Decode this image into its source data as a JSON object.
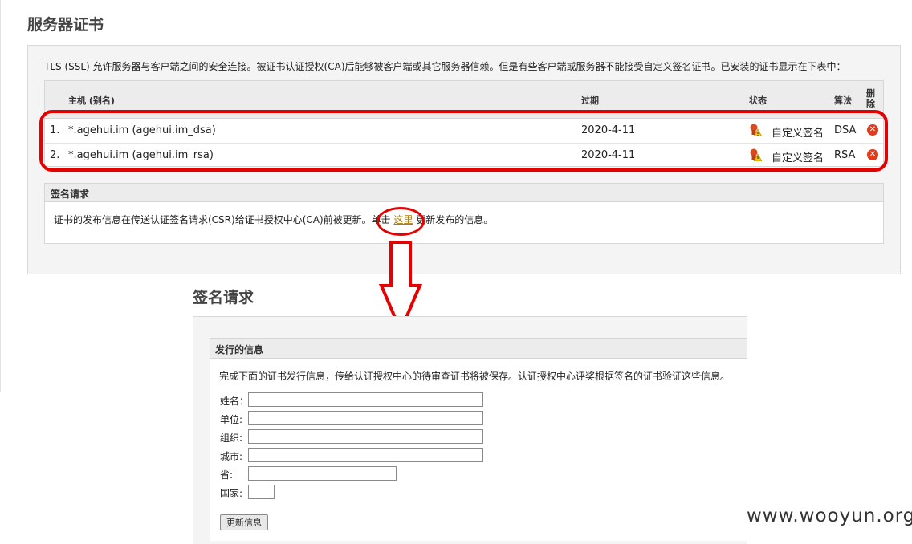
{
  "page": {
    "title": "服务器证书",
    "intro": "TLS (SSL) 允许服务器与客户端之间的安全连接。被证书认证授权(CA)后能够被客户端或其它服务器信赖。但是有些客户端或服务器不能接受自定义签名证书。已安装的证书显示在下表中："
  },
  "cert_table": {
    "headers": {
      "host": "主机 (别名)",
      "expires": "过期",
      "status": "状态",
      "algorithm": "算法",
      "delete": "删除"
    },
    "rows": [
      {
        "index": "1.",
        "host": "*.agehui.im (agehui.im_dsa)",
        "expires": "2020-4-11",
        "status": "自定义签名",
        "algorithm": "DSA"
      },
      {
        "index": "2.",
        "host": "*.agehui.im (agehui.im_rsa)",
        "expires": "2020-4-11",
        "status": "自定义签名",
        "algorithm": "RSA"
      }
    ],
    "delete_icon_glyph": "✕"
  },
  "csr": {
    "title": "签名请求",
    "text_before": "证书的发布信息在传送认证签名请求(CSR)给证书授权中心(CA)前被更新。单击 ",
    "link": "这里",
    "text_after": " 更新发布的信息。"
  },
  "signing_request": {
    "title": "签名请求",
    "section_title": "发行的信息",
    "description": "完成下面的证书发行信息，传给认证授权中心的待审查证书将被保存。认证授权中心评奖根据签名的证书验证这些信息。",
    "fields": [
      {
        "label": "姓名：",
        "value": ""
      },
      {
        "label": "单位:",
        "value": ""
      },
      {
        "label": "组织:",
        "value": ""
      },
      {
        "label": "城市:",
        "value": ""
      },
      {
        "label": "省:",
        "value": ""
      },
      {
        "label": "国家:",
        "value": ""
      }
    ],
    "submit_label": "更新信息"
  },
  "watermark": "www.wooyun.org",
  "colors": {
    "highlight": "#e60000",
    "delete_icon": "#e03b1c",
    "link": "#b27c00"
  },
  "icons": {
    "status": "warning-certificate-icon",
    "delete": "delete-icon"
  }
}
